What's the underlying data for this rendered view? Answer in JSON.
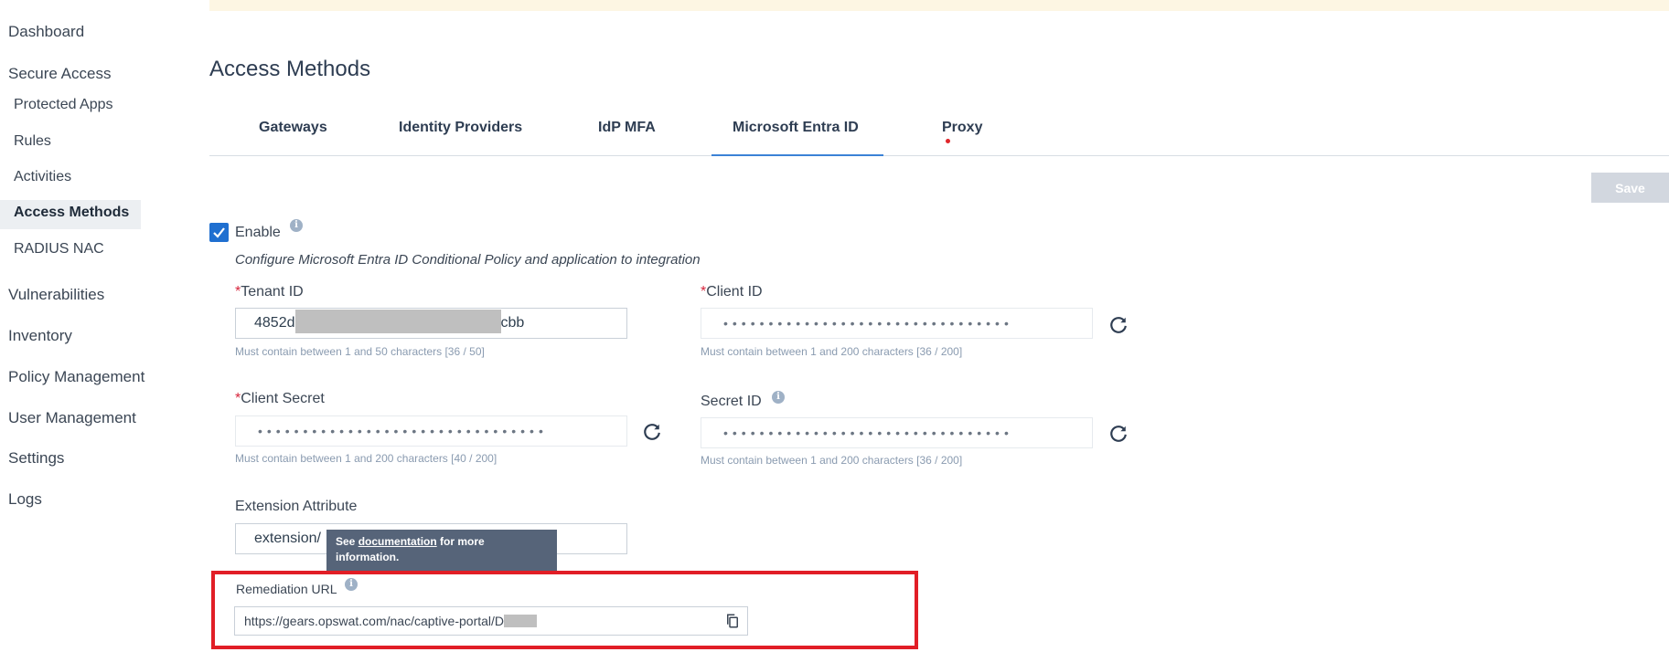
{
  "sidebar": {
    "items": [
      {
        "label": "Dashboard"
      },
      {
        "label": "Secure Access"
      },
      {
        "label": "Protected Apps"
      },
      {
        "label": "Rules"
      },
      {
        "label": "Activities"
      },
      {
        "label": "Access Methods"
      },
      {
        "label": "RADIUS NAC"
      },
      {
        "label": "Vulnerabilities"
      },
      {
        "label": "Inventory"
      },
      {
        "label": "Policy Management"
      },
      {
        "label": "User Management"
      },
      {
        "label": "Settings"
      },
      {
        "label": "Logs"
      }
    ],
    "active": "Access Methods"
  },
  "page": {
    "title": "Access Methods"
  },
  "tabs": [
    {
      "label": "Gateways"
    },
    {
      "label": "Identity Providers"
    },
    {
      "label": "IdP MFA"
    },
    {
      "label": "Microsoft Entra ID",
      "active": true
    },
    {
      "label": "Proxy"
    }
  ],
  "toolbar": {
    "save_label": "Save"
  },
  "form": {
    "enable_label": "Enable",
    "enabled": true,
    "description": "Configure Microsoft Entra ID Conditional Policy and application to integration",
    "required_mark": "*",
    "tenant_id": {
      "label": "Tenant ID",
      "value_prefix": "4852d",
      "value_suffix": "cbb",
      "hint": "Must contain between 1 and 50 characters [36 / 50]"
    },
    "client_id": {
      "label": "Client ID",
      "value": "••••••••••••••••••••••••••••••••",
      "hint": "Must contain between 1 and 200 characters [36 / 200]"
    },
    "client_secret": {
      "label": "Client Secret",
      "value": "••••••••••••••••••••••••••••••••",
      "hint": "Must contain between 1 and 200 characters [40 / 200]"
    },
    "secret_id": {
      "label": "Secret ID",
      "value": "••••••••••••••••••••••••••••••••",
      "hint": "Must contain between 1 and 200 characters [36 / 200]"
    },
    "extension_attribute": {
      "label": "Extension Attribute",
      "value": "extension/"
    },
    "tooltip": {
      "prefix": "See ",
      "link": "documentation",
      "suffix": " for more information."
    },
    "remediation_url": {
      "label": "Remediation URL",
      "value": "https://gears.opswat.com/nac/captive-portal/D"
    }
  },
  "colors": {
    "accent": "#1f6fd0",
    "highlight": "#e11e26",
    "required": "#d7263d",
    "tab_underline": "#3b82d6",
    "tooltip_bg": "#566479"
  },
  "icons": {
    "info": "info-icon",
    "refresh": "refresh-icon",
    "copy": "copy-icon",
    "check": "check-icon"
  }
}
